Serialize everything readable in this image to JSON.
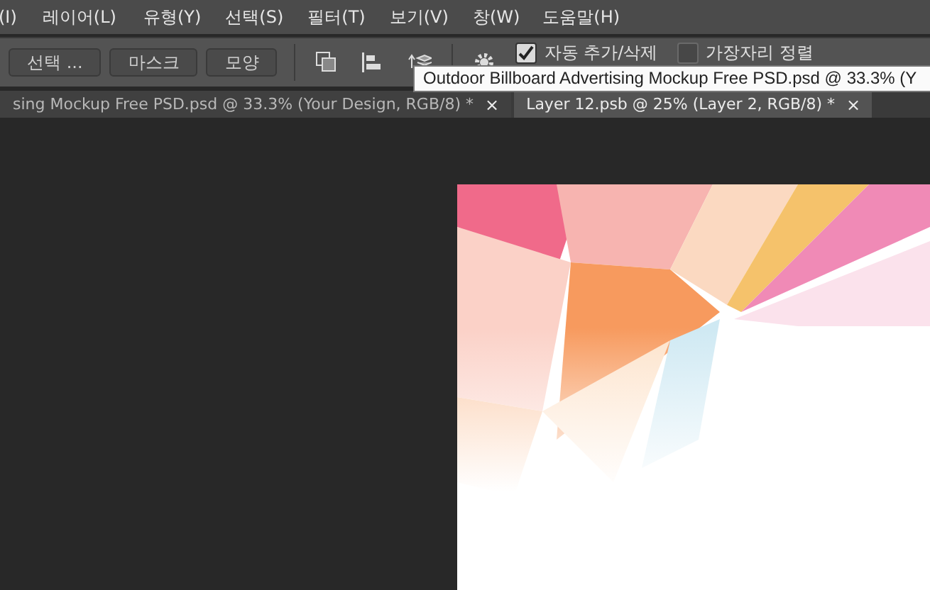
{
  "menu_bar": {
    "items": [
      {
        "label": "(I)"
      },
      {
        "label": "레이어(L)"
      },
      {
        "label": "유형(Y)"
      },
      {
        "label": "선택(S)"
      },
      {
        "label": "필터(T)"
      },
      {
        "label": "보기(V)"
      },
      {
        "label": "창(W)"
      },
      {
        "label": "도움말(H)"
      }
    ]
  },
  "options_bar": {
    "buttons": [
      "선택 ...",
      "마스크",
      "모양"
    ],
    "checkboxes": [
      {
        "label": "자동 추가/삭제",
        "checked": true
      },
      {
        "label": "가장자리 정렬",
        "checked": false
      }
    ]
  },
  "tooltip": "Outdoor Billboard Advertising Mockup Free PSD.psd @ 33.3% (Y",
  "document_tabs": [
    {
      "title": "sing Mockup Free PSD.psd @ 33.3% (Your Design, RGB/8) *",
      "close": "×",
      "selected": false
    },
    {
      "title": "Layer 12.psb @ 25% (Layer 2, RGB/8) *",
      "close": "×",
      "selected": true
    }
  ]
}
